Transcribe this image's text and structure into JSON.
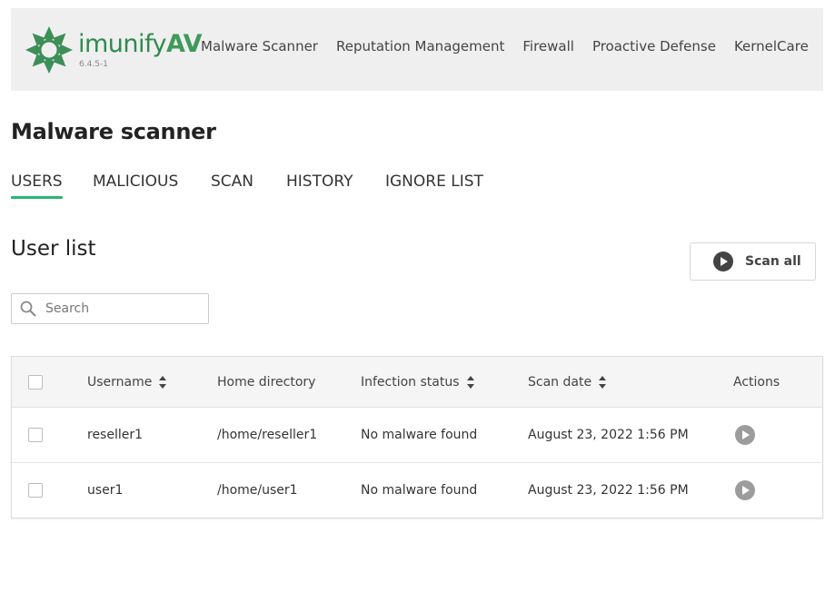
{
  "header": {
    "brand_name": "imunify",
    "brand_suffix": "AV",
    "version": "6.4.5-1",
    "brand_color": "#2e8a4e",
    "nav": [
      {
        "label": "Malware Scanner"
      },
      {
        "label": "Reputation Management"
      },
      {
        "label": "Firewall"
      },
      {
        "label": "Proactive Defense"
      },
      {
        "label": "KernelCare"
      }
    ]
  },
  "page": {
    "title": "Malware scanner",
    "tabs": [
      {
        "label": "USERS",
        "active": true
      },
      {
        "label": "MALICIOUS",
        "active": false
      },
      {
        "label": "SCAN",
        "active": false
      },
      {
        "label": "HISTORY",
        "active": false
      },
      {
        "label": "IGNORE LIST",
        "active": false
      }
    ],
    "tab_accent": "#2bb673"
  },
  "user_list": {
    "title": "User list",
    "scan_all_label": "Scan all",
    "search_placeholder": "Search",
    "search_value": "",
    "columns": {
      "username": "Username",
      "home": "Home directory",
      "status": "Infection status",
      "date": "Scan date",
      "actions": "Actions"
    },
    "rows": [
      {
        "username": "reseller1",
        "home": "/home/reseller1",
        "status": "No malware found",
        "date": "August 23, 2022 1:56 PM"
      },
      {
        "username": "user1",
        "home": "/home/user1",
        "status": "No malware found",
        "date": "August 23, 2022 1:56 PM"
      }
    ]
  }
}
